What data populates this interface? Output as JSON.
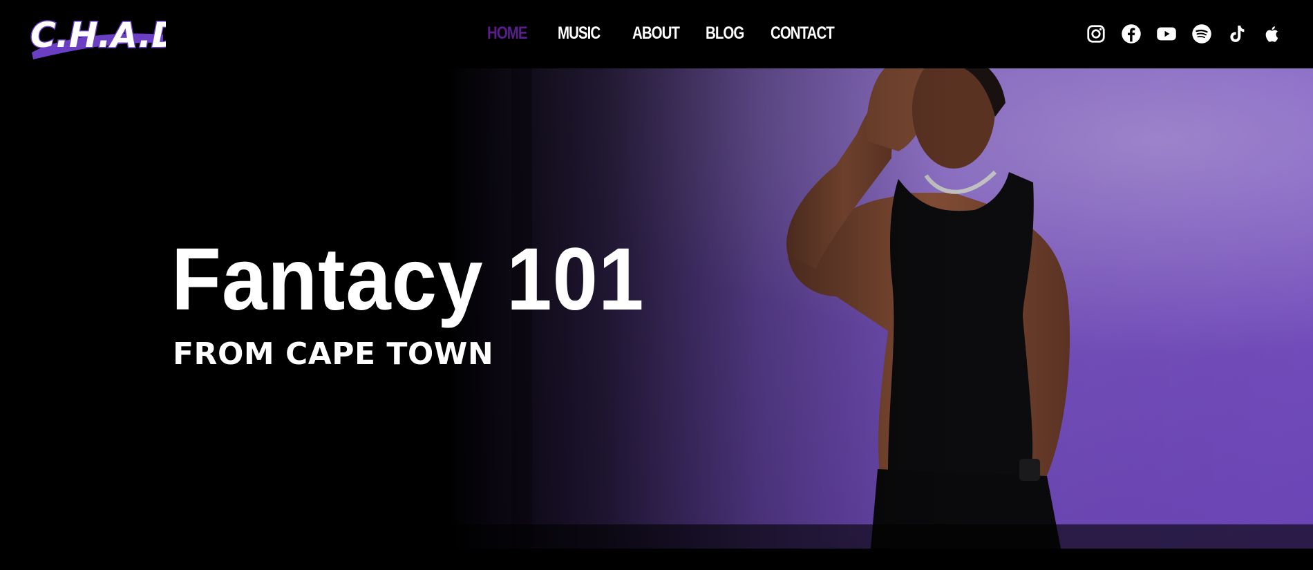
{
  "brand": {
    "logo_text": "C.H.A.D",
    "accent_color": "#6a3fc4"
  },
  "nav": {
    "items": [
      {
        "label": "HOME",
        "active": true
      },
      {
        "label": "MUSIC",
        "active": false
      },
      {
        "label": "ABOUT",
        "active": false
      },
      {
        "label": "BLOG",
        "active": false
      },
      {
        "label": "CONTACT",
        "active": false
      }
    ],
    "active_color": "#5a1e8c"
  },
  "social": {
    "icons": [
      "instagram-icon",
      "facebook-icon",
      "youtube-icon",
      "spotify-icon",
      "tiktok-icon",
      "apple-icon"
    ]
  },
  "hero": {
    "title": "Fantacy 101",
    "subtitle": "FROM CAPE TOWN",
    "background_color": "#7b57c2"
  }
}
